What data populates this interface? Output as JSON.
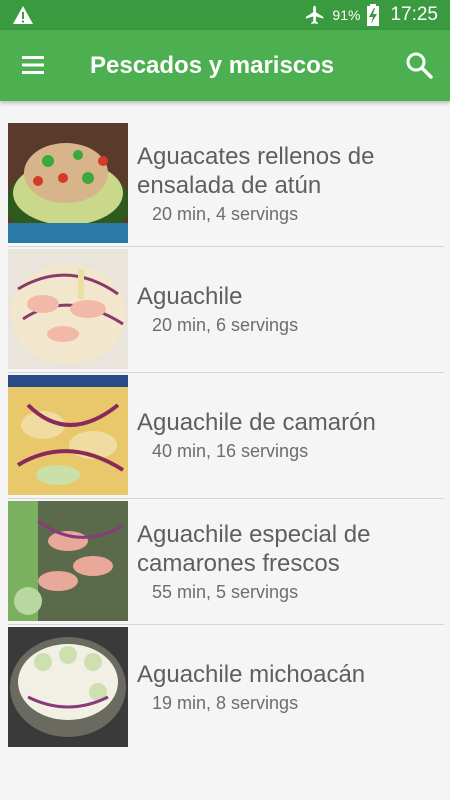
{
  "status_bar": {
    "warning_icon": "warning-triangle-icon",
    "airplane_icon": "airplane-mode-icon",
    "battery_percent": "91%",
    "battery_icon": "battery-charging-icon",
    "time": "17:25"
  },
  "app_bar": {
    "menu_icon": "hamburger-menu-icon",
    "title": "Pescados y mariscos",
    "search_icon": "search-icon",
    "color": "#4caf50"
  },
  "recipes": [
    {
      "name": "Aguacates rellenos de ensalada de atún",
      "meta": "20 min, 4 servings"
    },
    {
      "name": "Aguachile",
      "meta": "20 min, 6 servings"
    },
    {
      "name": "Aguachile de camarón",
      "meta": "40 min, 16 servings"
    },
    {
      "name": "Aguachile especial de camarones frescos",
      "meta": "55 min, 5 servings"
    },
    {
      "name": "Aguachile michoacán",
      "meta": "19 min, 8 servings"
    }
  ]
}
